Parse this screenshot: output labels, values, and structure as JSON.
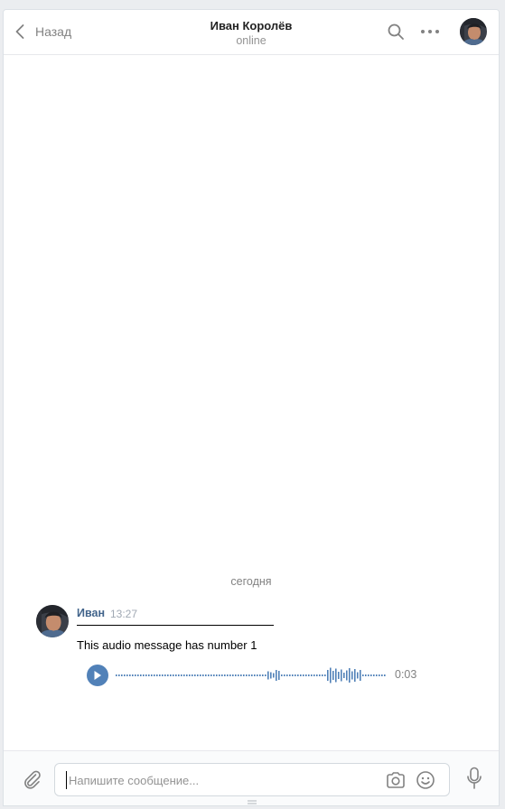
{
  "header": {
    "back_label": "Назад",
    "title": "Иван Королёв",
    "status": "online"
  },
  "date_divider": "сегодня",
  "message": {
    "author": "Иван",
    "time": "13:27",
    "text": "This audio message has number 1",
    "audio_duration": "0:03"
  },
  "composer": {
    "placeholder": "Напишите сообщение..."
  },
  "colors": {
    "accent": "#5181b8",
    "author": "#42648b",
    "background": "#ebedf0"
  }
}
